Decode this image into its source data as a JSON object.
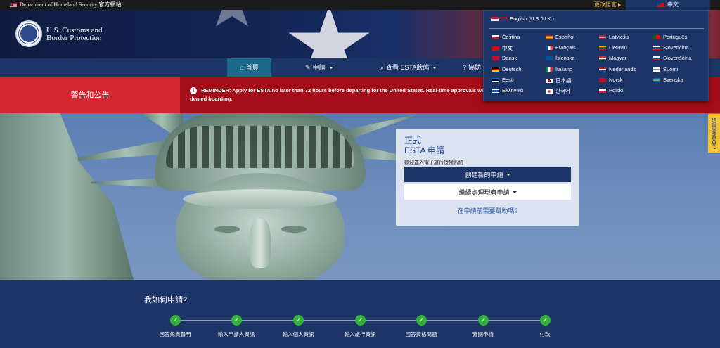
{
  "topbar": {
    "agency": "Department of Homeland Security 官方網站",
    "change_language": "更改語言",
    "current_language": "中文"
  },
  "header": {
    "org_line1": "U.S. Customs and",
    "org_line2": "Border Protection"
  },
  "nav": {
    "home": "首頁",
    "apply": "申請",
    "check_status": "查看 ESTA狀態",
    "help": "協助"
  },
  "alert": {
    "title": "警告和公告",
    "message_line1": "REMINDER: Apply for ESTA no later than 72 hours before departing for the United States. Real-time approvals will no longer be g",
    "message_line2": "denied boarding."
  },
  "panel": {
    "title_line1": "正式",
    "title_line2": "ESTA 申請",
    "subtitle": "歡迎進入電子旅行授權系統",
    "new_application": "創建新的申請",
    "continue_application": "繼續處理現有申請",
    "help_link": "在申請前需要幫助嗎?"
  },
  "feedback_tab": "請惠賜意見?",
  "steps": {
    "heading": "我如何申請?",
    "items": [
      "回答免責聲明",
      "輸入申請人資訊",
      "輸入個人資訊",
      "輸入旅行資訊",
      "回答資格問題",
      "審閱申請",
      "付款"
    ]
  },
  "language_menu": {
    "header": "English (U.S./U.K.)",
    "columns": [
      [
        "Čeština",
        "中文",
        "Dansk",
        "Deutsch",
        "Eesti",
        "Ελληνικά"
      ],
      [
        "Español",
        "Français",
        "Íslenska",
        "Italiano",
        "日本語",
        "한국어"
      ],
      [
        "Latviešu",
        "Lietuvių",
        "Magyar",
        "Nederlands",
        "Norsk",
        "Polski"
      ],
      [
        "Português",
        "Slovenčina",
        "Slovenščina",
        "Suomi",
        "Svenska"
      ]
    ]
  },
  "colors": {
    "navy": "#1d3466",
    "alert_red": "#d22532",
    "alert_dark": "#a20d17",
    "success_green": "#34b13b",
    "feedback_yellow": "#f2c233"
  }
}
